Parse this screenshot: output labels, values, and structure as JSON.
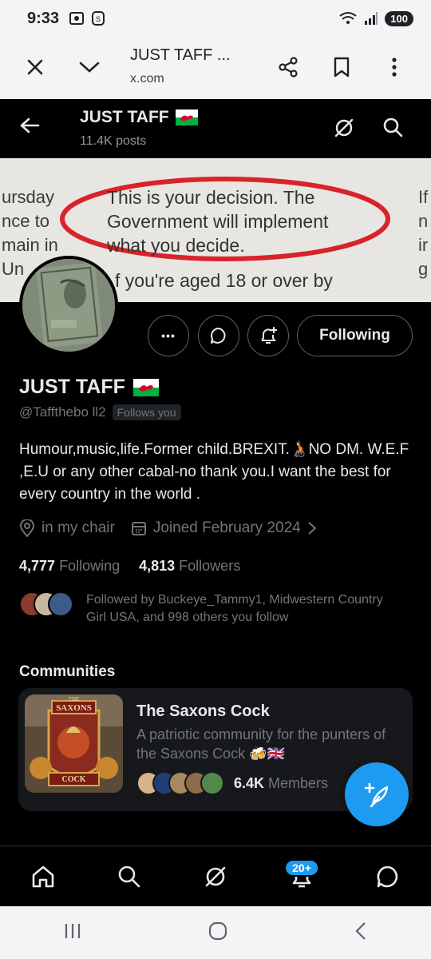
{
  "status_bar": {
    "time": "9:33",
    "battery": "100"
  },
  "browser": {
    "title": "JUST TAFF ...",
    "url": "x.com"
  },
  "top_nav": {
    "name": "JUST TAFF",
    "posts": "11.4K posts"
  },
  "banner": {
    "left_lines": [
      "ursday",
      "nce to",
      "main in",
      "Un"
    ],
    "center_lines": [
      "This is your decision. The",
      "Government will implement",
      "what you decide."
    ],
    "bottom_line": "f you're aged 18 or over by",
    "right_lines": [
      "If",
      "n",
      "ir",
      "g"
    ]
  },
  "actions": {
    "following_label": "Following",
    "more_label": "•••"
  },
  "profile": {
    "name": "JUST TAFF",
    "handle": "@Taffthebo ll2",
    "follows_you": "Follows you",
    "bio": "Humour,music,life.Former child.BREXIT.​🧑‍🦽NO DM. W.E.F ,E.U or any other cabal-no thank you.I want the best for every country in the world .",
    "location": "in my chair",
    "joined": "Joined February 2024",
    "following_count": "4,777",
    "following_label": "Following",
    "followers_count": "4,813",
    "followers_label": "Followers",
    "followed_by": "Followed by Buckeye_Tammy1, Midwestern Country Girl USA, and 998 others you follow"
  },
  "communities": {
    "heading": "Communities",
    "card": {
      "img_top": "THE",
      "img_title": "SAXONS",
      "img_bottom": "COCK",
      "title": "The Saxons Cock",
      "description": "A patriotic community for the punters of the Saxons Cock 🍻🇬🇧",
      "members_count": "6.4K",
      "members_label": "Members"
    }
  },
  "tabbar": {
    "notifications_badge": "20+"
  },
  "colors": {
    "accent": "#1d9bf0",
    "background": "#000000",
    "muted": "#71767b",
    "banner_circle": "#d8232a"
  },
  "icons": [
    "close-icon",
    "chevron-down-icon",
    "share-icon",
    "bookmark-icon",
    "more-vert-icon",
    "back-arrow-icon",
    "grok-icon",
    "search-icon",
    "chat-icon",
    "bell-plus-icon",
    "location-icon",
    "calendar-icon",
    "compose-icon",
    "home-icon",
    "bell-icon",
    "messages-icon"
  ]
}
